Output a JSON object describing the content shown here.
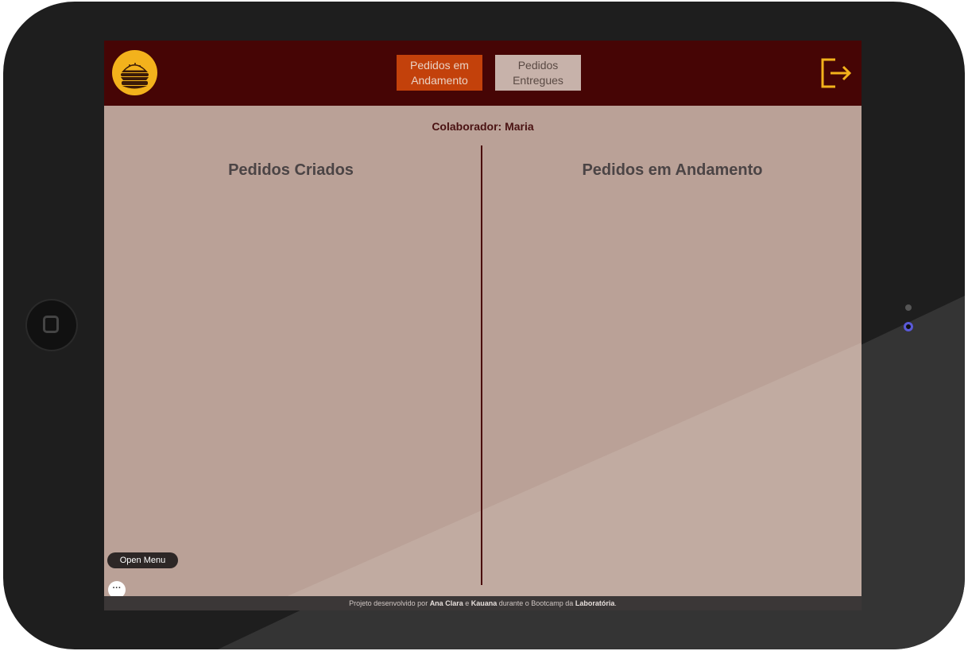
{
  "header": {
    "tabs": [
      {
        "label": "Pedidos em Andamento",
        "active": true
      },
      {
        "label": "Pedidos Entregues",
        "active": false
      }
    ],
    "logo_icon": "burger-logo-icon",
    "logout_icon": "logout-icon"
  },
  "main": {
    "collaborator": "Colaborador: Maria",
    "columns": [
      {
        "title": "Pedidos Criados"
      },
      {
        "title": "Pedidos em Andamento"
      }
    ]
  },
  "overlay": {
    "open_menu_label": "Open Menu",
    "dots_label": "···"
  },
  "footer": {
    "prefix": "Projeto desenvolvido por ",
    "name1": "Ana Clara",
    "and": " e ",
    "name2": "Kauana",
    "middle": " durante o Bootcamp da ",
    "org": "Laboratória",
    "suffix": "."
  },
  "colors": {
    "header_bg": "#460505",
    "content_bg": "#baa197",
    "active_tab": "#c3410b",
    "inactive_tab": "#c7b2aa",
    "accent_yellow": "#f3b21c",
    "divider": "#4a0a0a"
  }
}
